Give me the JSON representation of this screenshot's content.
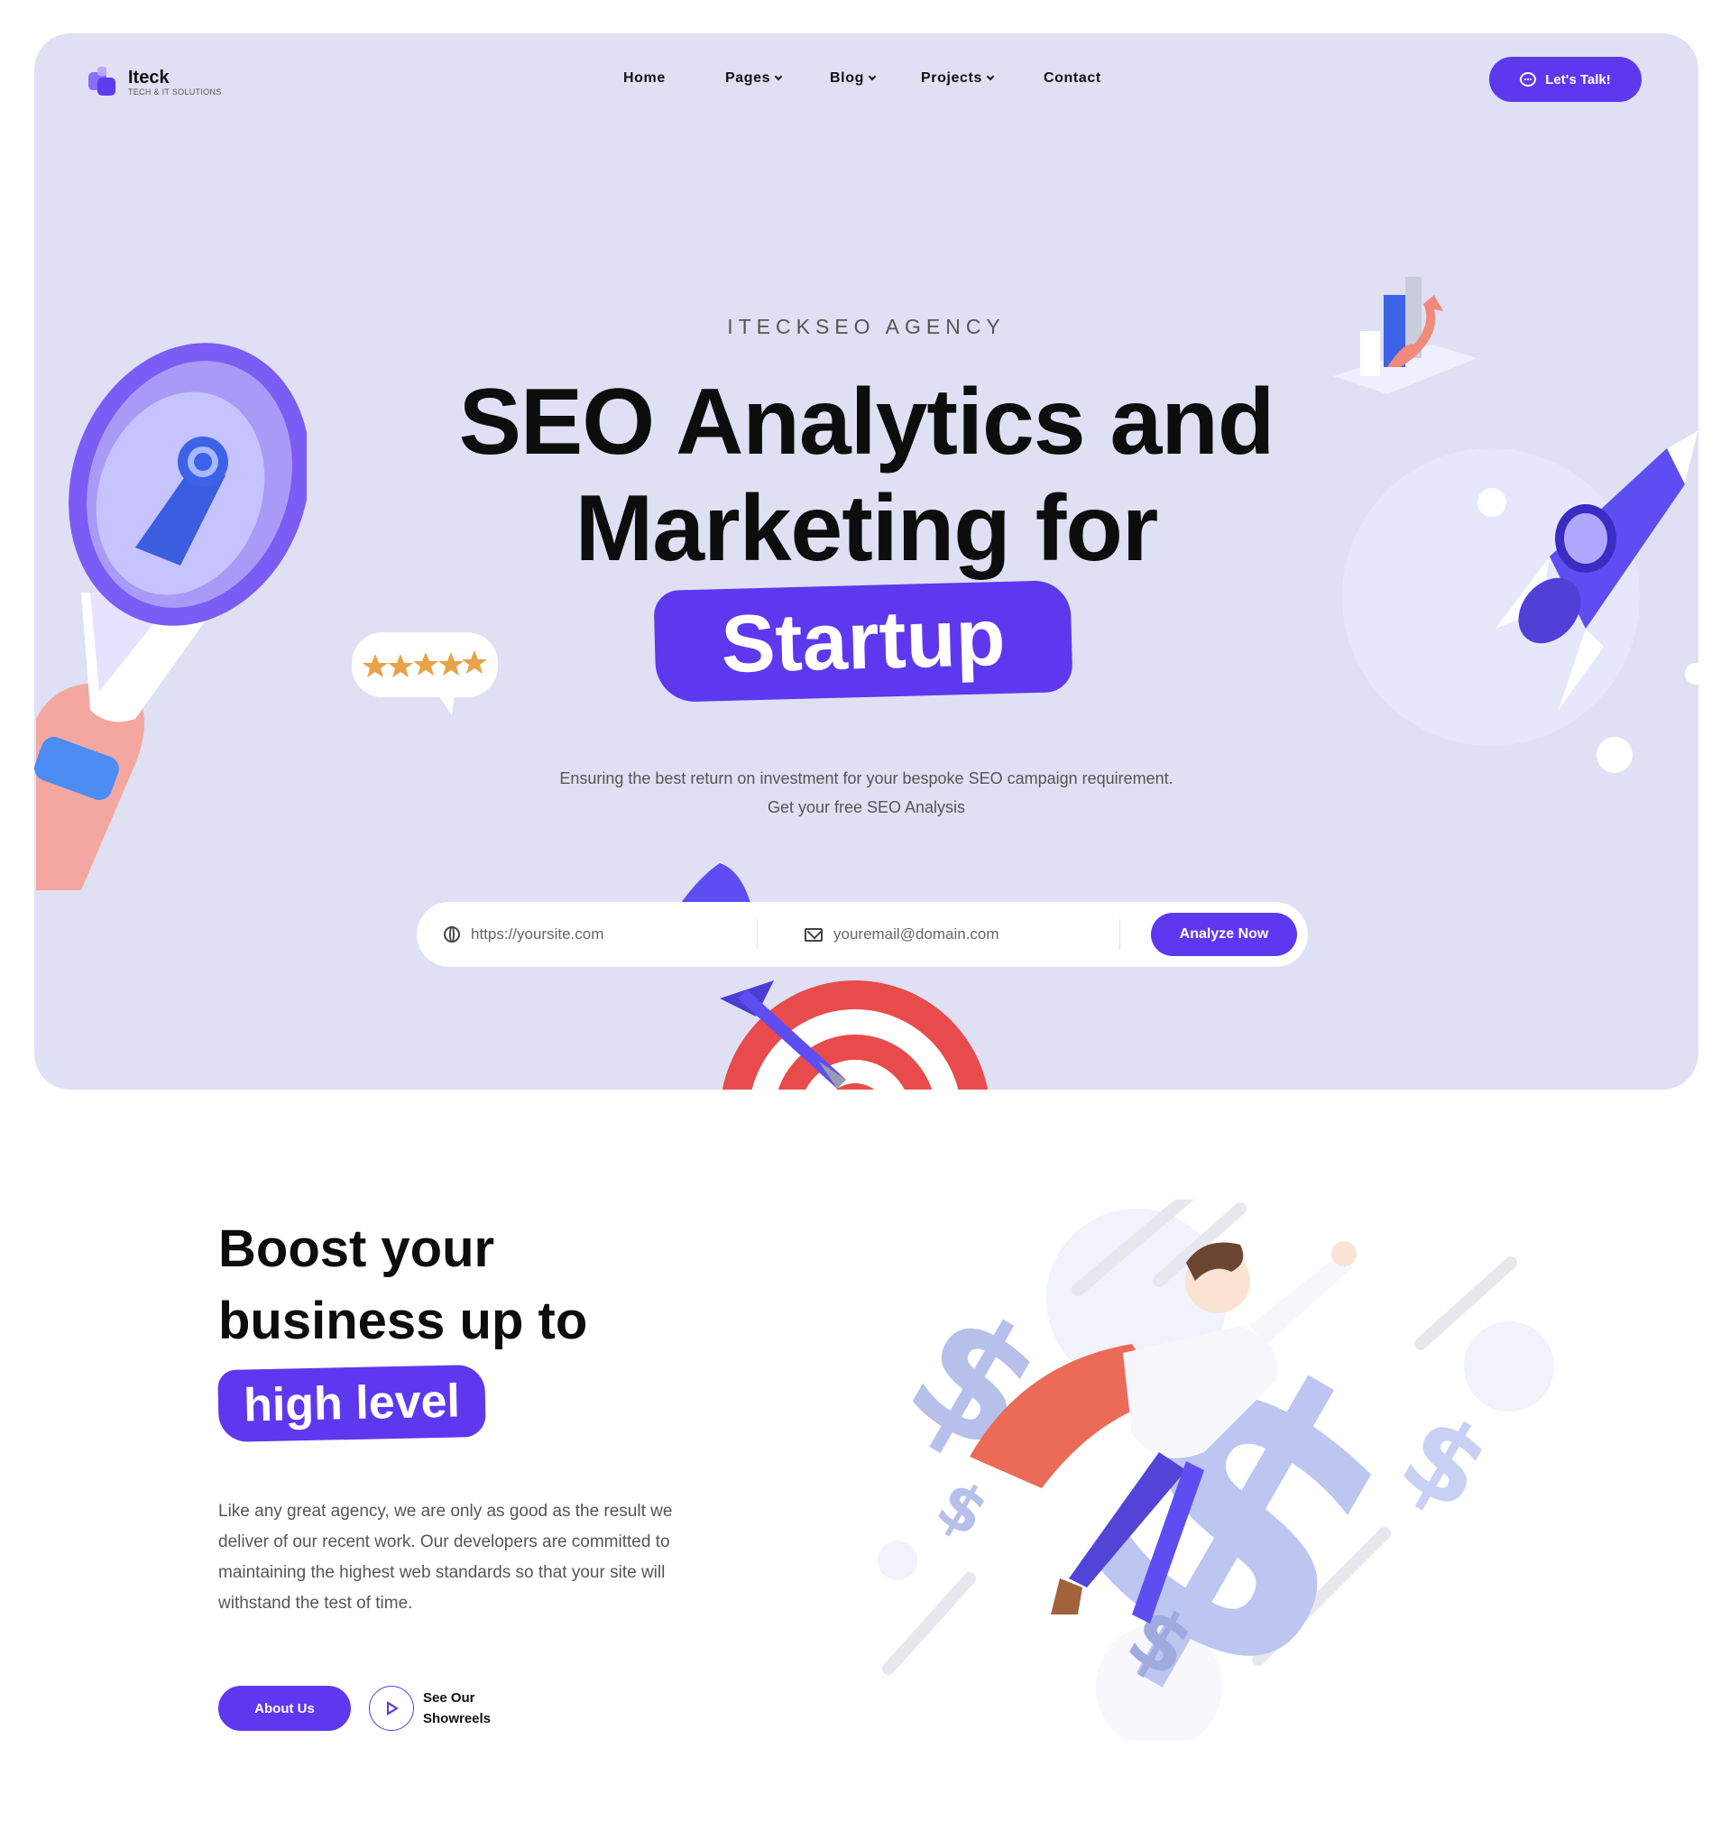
{
  "brand": {
    "name": "Iteck",
    "tagline": "TECH & IT SOLUTIONS"
  },
  "nav": {
    "items": [
      {
        "label": "Home",
        "has_dropdown": false
      },
      {
        "label": "Pages",
        "has_dropdown": true
      },
      {
        "label": "Blog",
        "has_dropdown": true
      },
      {
        "label": "Projects",
        "has_dropdown": true
      },
      {
        "label": "Contact",
        "has_dropdown": false
      }
    ],
    "cta_label": "Let's Talk!"
  },
  "hero": {
    "eyebrow": "ITECKSEO AGENCY",
    "headline_line1": "SEO Analytics and",
    "headline_line2": "Marketing for",
    "headline_highlight": "Startup",
    "subtitle_line1": "Ensuring the best return on investment for your bespoke SEO campaign requirement.",
    "subtitle_line2": "Get your free SEO Analysis",
    "form": {
      "url_placeholder": "https://yoursite.com",
      "email_placeholder": "youremail@domain.com",
      "submit_label": "Analyze Now"
    }
  },
  "about": {
    "title_line1": "Boost your",
    "title_line2": "business up to",
    "title_highlight": "high level",
    "description": "Like any great agency, we are only as good as the result we deliver of our recent work. Our developers are committed to maintaining the highest web standards so that your site will withstand the test of time.",
    "primary_button": "About Us",
    "showreel_label": "See Our Showreels"
  },
  "colors": {
    "accent": "#5e38ef",
    "hero_bg": "#dfe0f3",
    "text_dark": "#0d0d0d",
    "text_muted": "#555555"
  },
  "icons": [
    "logo-mark",
    "chevron-down-icon",
    "chat-icon",
    "globe-icon",
    "mail-icon",
    "play-icon",
    "megaphone-illustration",
    "rocket-illustration",
    "chart-illustration",
    "rating-stars-bubble",
    "target-dart-illustration",
    "superhero-dollar-illustration"
  ]
}
